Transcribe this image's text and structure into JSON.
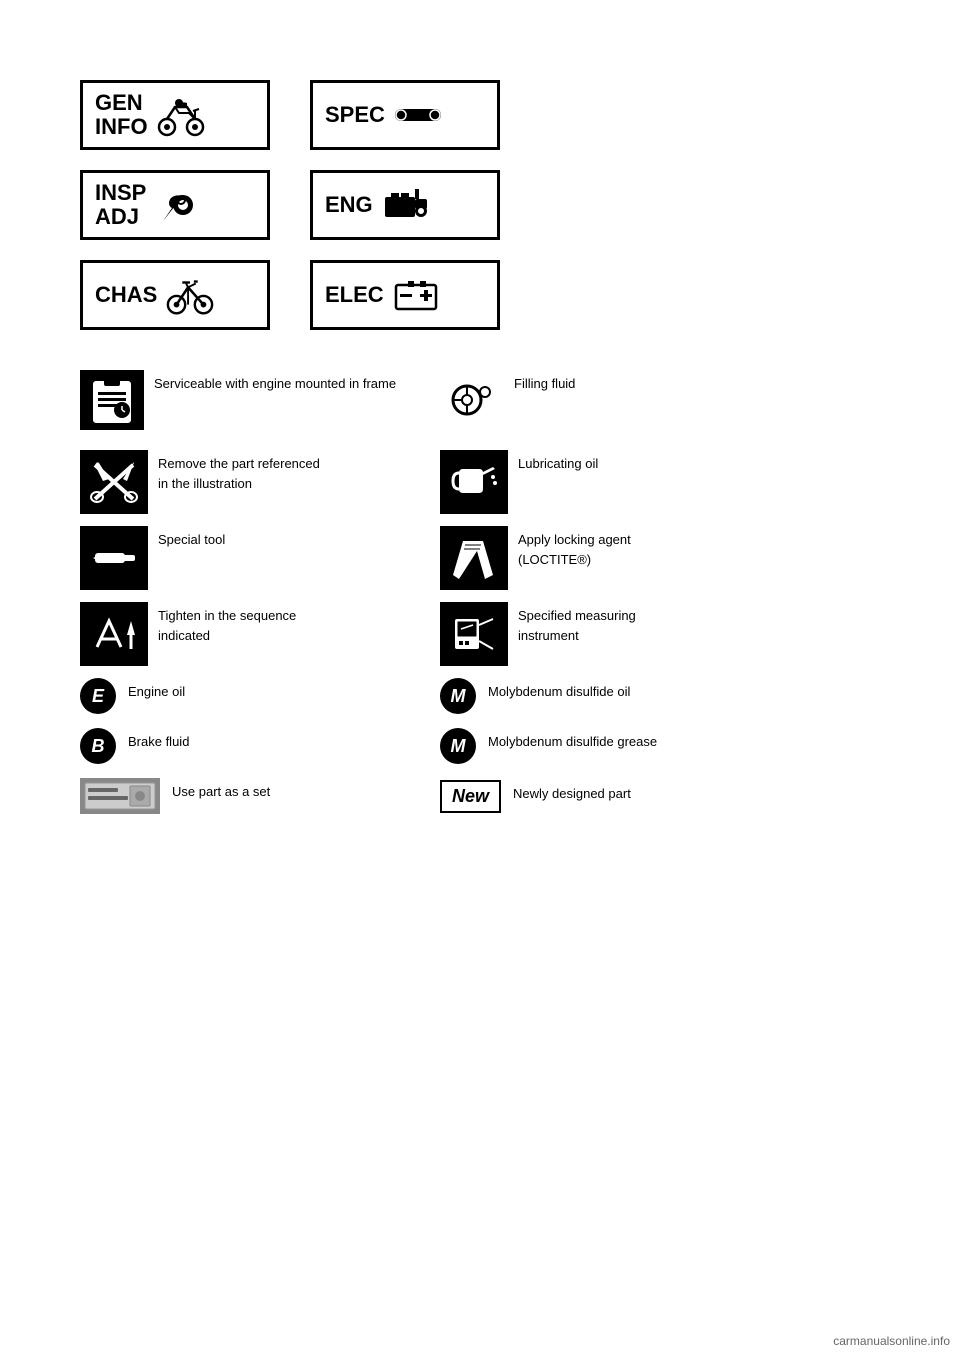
{
  "page": {
    "background": "#ffffff"
  },
  "sectionIcons": [
    {
      "row": 1,
      "items": [
        {
          "id": "gen-info",
          "label": "GEN\nINFO",
          "iconType": "motorcycle"
        },
        {
          "id": "spec",
          "label": "SPEC",
          "iconType": "tools"
        }
      ]
    },
    {
      "row": 2,
      "items": [
        {
          "id": "insp-adj",
          "label": "INSP\nADJ",
          "iconType": "wrench"
        },
        {
          "id": "eng",
          "label": "ENG",
          "iconType": "engine"
        }
      ]
    },
    {
      "row": 3,
      "items": [
        {
          "id": "chas",
          "label": "CHAS",
          "iconType": "bicycle"
        },
        {
          "id": "elec",
          "label": "ELEC",
          "iconType": "battery"
        }
      ]
    }
  ],
  "symbolsHeader": {
    "col1Icon": "clipboard-clock",
    "col1Text": "Serviceable with engine mounted in frame",
    "col2Icon": "steering",
    "col2Text": "Filling fluid"
  },
  "symbolRows": [
    {
      "col1": {
        "icon": "scissors-pliers",
        "text": "Remove the part referenced in the illustration"
      },
      "col2": {
        "icon": "oil-can",
        "text": "Lubricating oil"
      }
    },
    {
      "col1": {
        "icon": "punch-tool",
        "text": "Special tool"
      },
      "col2": {
        "icon": "hook-tool",
        "text": "Apply locking agent (LOCTITE®)"
      }
    },
    {
      "col1": {
        "icon": "tightening",
        "text": "Tighten in the sequence indicated"
      },
      "col2": {
        "icon": "meter",
        "text": "Specified measuring instrument"
      }
    }
  ],
  "circleIconRows": [
    {
      "col1": {
        "letter": "E",
        "italic": true,
        "text": "Engine oil"
      },
      "col2": {
        "letter": "M",
        "italic": true,
        "text": "Molybdenum disulfide oil"
      }
    },
    {
      "col1": {
        "letter": "B",
        "italic": true,
        "text": "Brake fluid"
      },
      "col2": {
        "letter": "M",
        "italic": true,
        "text": "Molybdenum disulfide grease"
      }
    }
  ],
  "partRow": {
    "col1": {
      "iconType": "part-box",
      "text": "Use part as a set"
    },
    "col2": {
      "iconType": "new-label",
      "text": "New"
    }
  },
  "watermark": "carmanualsonline.info"
}
